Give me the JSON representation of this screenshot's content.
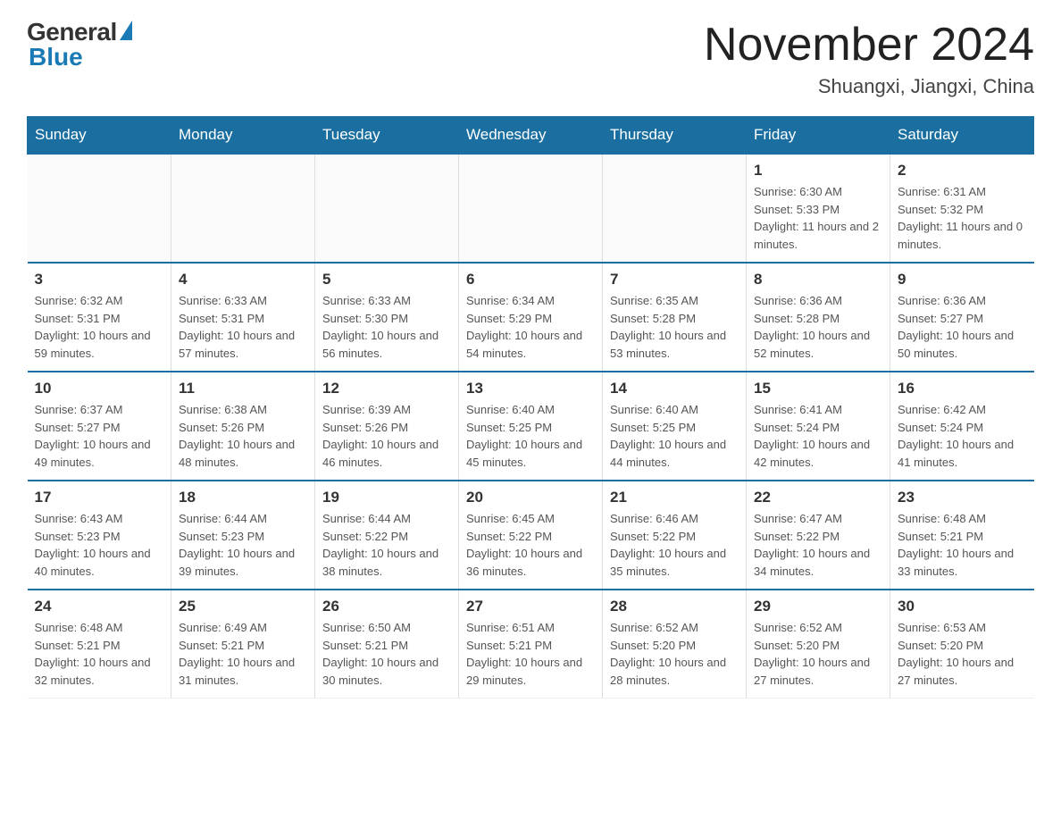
{
  "header": {
    "logo": {
      "general": "General",
      "blue": "Blue"
    },
    "title": "November 2024",
    "location": "Shuangxi, Jiangxi, China"
  },
  "weekdays": [
    "Sunday",
    "Monday",
    "Tuesday",
    "Wednesday",
    "Thursday",
    "Friday",
    "Saturday"
  ],
  "weeks": [
    {
      "days": [
        {
          "num": "",
          "info": ""
        },
        {
          "num": "",
          "info": ""
        },
        {
          "num": "",
          "info": ""
        },
        {
          "num": "",
          "info": ""
        },
        {
          "num": "",
          "info": ""
        },
        {
          "num": "1",
          "info": "Sunrise: 6:30 AM\nSunset: 5:33 PM\nDaylight: 11 hours and 2 minutes."
        },
        {
          "num": "2",
          "info": "Sunrise: 6:31 AM\nSunset: 5:32 PM\nDaylight: 11 hours and 0 minutes."
        }
      ]
    },
    {
      "days": [
        {
          "num": "3",
          "info": "Sunrise: 6:32 AM\nSunset: 5:31 PM\nDaylight: 10 hours and 59 minutes."
        },
        {
          "num": "4",
          "info": "Sunrise: 6:33 AM\nSunset: 5:31 PM\nDaylight: 10 hours and 57 minutes."
        },
        {
          "num": "5",
          "info": "Sunrise: 6:33 AM\nSunset: 5:30 PM\nDaylight: 10 hours and 56 minutes."
        },
        {
          "num": "6",
          "info": "Sunrise: 6:34 AM\nSunset: 5:29 PM\nDaylight: 10 hours and 54 minutes."
        },
        {
          "num": "7",
          "info": "Sunrise: 6:35 AM\nSunset: 5:28 PM\nDaylight: 10 hours and 53 minutes."
        },
        {
          "num": "8",
          "info": "Sunrise: 6:36 AM\nSunset: 5:28 PM\nDaylight: 10 hours and 52 minutes."
        },
        {
          "num": "9",
          "info": "Sunrise: 6:36 AM\nSunset: 5:27 PM\nDaylight: 10 hours and 50 minutes."
        }
      ]
    },
    {
      "days": [
        {
          "num": "10",
          "info": "Sunrise: 6:37 AM\nSunset: 5:27 PM\nDaylight: 10 hours and 49 minutes."
        },
        {
          "num": "11",
          "info": "Sunrise: 6:38 AM\nSunset: 5:26 PM\nDaylight: 10 hours and 48 minutes."
        },
        {
          "num": "12",
          "info": "Sunrise: 6:39 AM\nSunset: 5:26 PM\nDaylight: 10 hours and 46 minutes."
        },
        {
          "num": "13",
          "info": "Sunrise: 6:40 AM\nSunset: 5:25 PM\nDaylight: 10 hours and 45 minutes."
        },
        {
          "num": "14",
          "info": "Sunrise: 6:40 AM\nSunset: 5:25 PM\nDaylight: 10 hours and 44 minutes."
        },
        {
          "num": "15",
          "info": "Sunrise: 6:41 AM\nSunset: 5:24 PM\nDaylight: 10 hours and 42 minutes."
        },
        {
          "num": "16",
          "info": "Sunrise: 6:42 AM\nSunset: 5:24 PM\nDaylight: 10 hours and 41 minutes."
        }
      ]
    },
    {
      "days": [
        {
          "num": "17",
          "info": "Sunrise: 6:43 AM\nSunset: 5:23 PM\nDaylight: 10 hours and 40 minutes."
        },
        {
          "num": "18",
          "info": "Sunrise: 6:44 AM\nSunset: 5:23 PM\nDaylight: 10 hours and 39 minutes."
        },
        {
          "num": "19",
          "info": "Sunrise: 6:44 AM\nSunset: 5:22 PM\nDaylight: 10 hours and 38 minutes."
        },
        {
          "num": "20",
          "info": "Sunrise: 6:45 AM\nSunset: 5:22 PM\nDaylight: 10 hours and 36 minutes."
        },
        {
          "num": "21",
          "info": "Sunrise: 6:46 AM\nSunset: 5:22 PM\nDaylight: 10 hours and 35 minutes."
        },
        {
          "num": "22",
          "info": "Sunrise: 6:47 AM\nSunset: 5:22 PM\nDaylight: 10 hours and 34 minutes."
        },
        {
          "num": "23",
          "info": "Sunrise: 6:48 AM\nSunset: 5:21 PM\nDaylight: 10 hours and 33 minutes."
        }
      ]
    },
    {
      "days": [
        {
          "num": "24",
          "info": "Sunrise: 6:48 AM\nSunset: 5:21 PM\nDaylight: 10 hours and 32 minutes."
        },
        {
          "num": "25",
          "info": "Sunrise: 6:49 AM\nSunset: 5:21 PM\nDaylight: 10 hours and 31 minutes."
        },
        {
          "num": "26",
          "info": "Sunrise: 6:50 AM\nSunset: 5:21 PM\nDaylight: 10 hours and 30 minutes."
        },
        {
          "num": "27",
          "info": "Sunrise: 6:51 AM\nSunset: 5:21 PM\nDaylight: 10 hours and 29 minutes."
        },
        {
          "num": "28",
          "info": "Sunrise: 6:52 AM\nSunset: 5:20 PM\nDaylight: 10 hours and 28 minutes."
        },
        {
          "num": "29",
          "info": "Sunrise: 6:52 AM\nSunset: 5:20 PM\nDaylight: 10 hours and 27 minutes."
        },
        {
          "num": "30",
          "info": "Sunrise: 6:53 AM\nSunset: 5:20 PM\nDaylight: 10 hours and 27 minutes."
        }
      ]
    }
  ]
}
